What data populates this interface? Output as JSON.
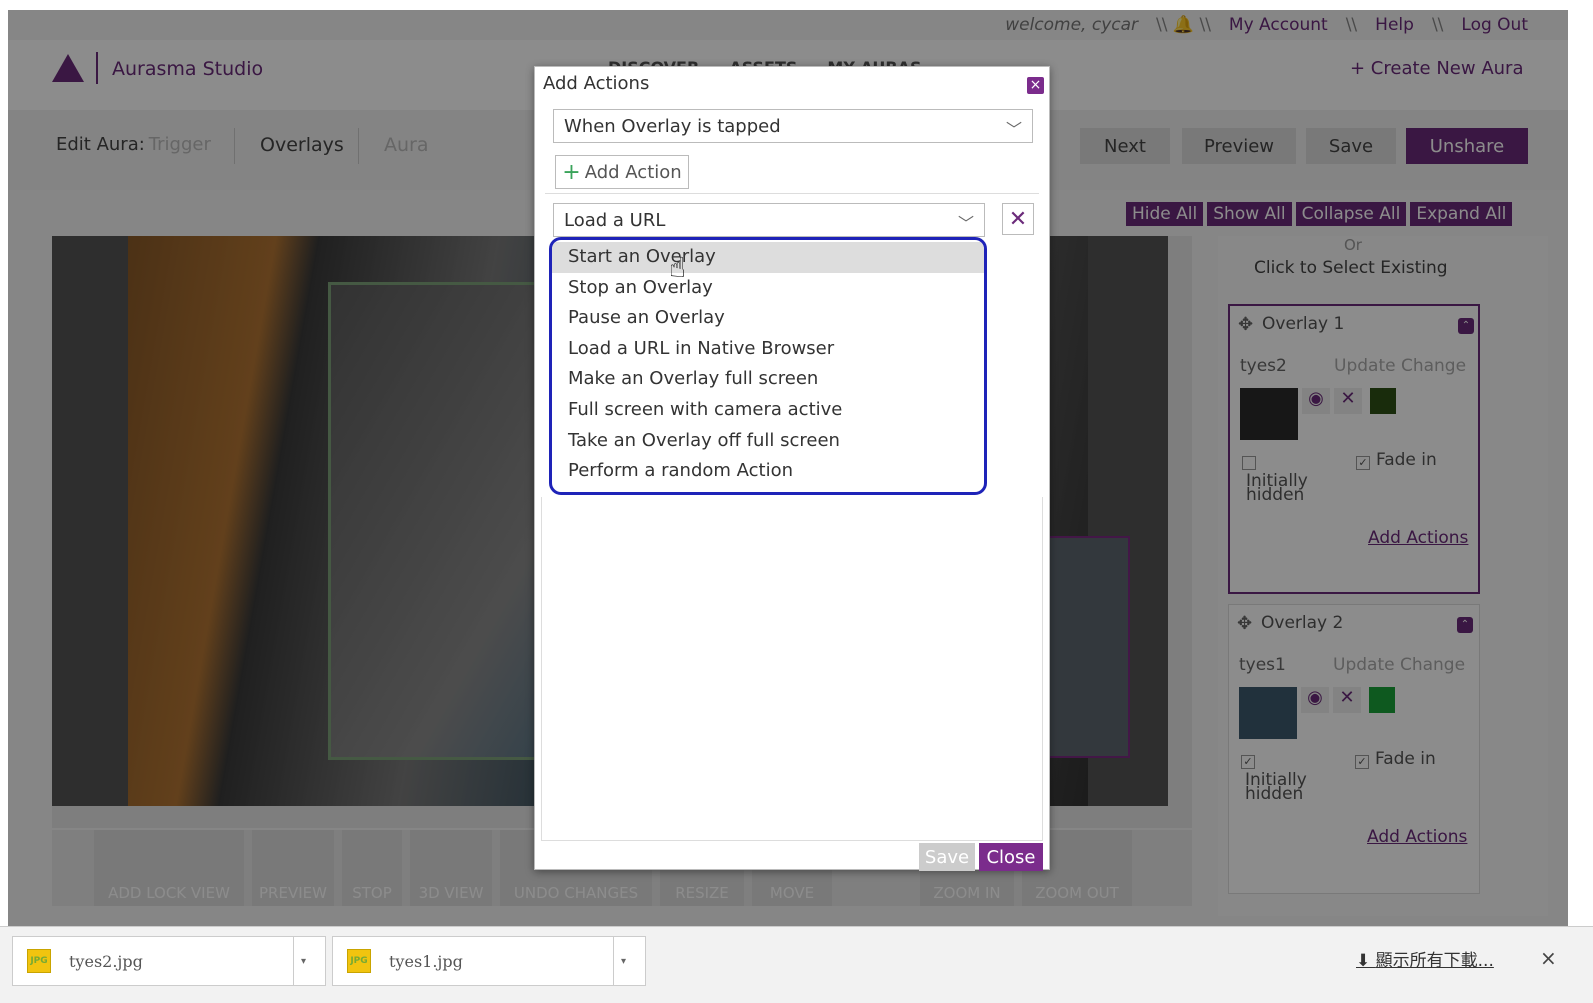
{
  "topbar": {
    "welcome": "welcome, cycar",
    "sep1": "\\\\ 🔔 \\\\",
    "my_account": "My Account",
    "sep2": "\\\\",
    "help": "Help",
    "sep3": "\\\\",
    "logout": "Log Out"
  },
  "header": {
    "logo_text": "Aurasma Studio",
    "nav": [
      "DISCOVER",
      "ASSETS",
      "MY AURAS"
    ],
    "create": "+ Create New Aura"
  },
  "editbar": {
    "label": "Edit Aura:",
    "tabs": [
      "Trigger",
      "Overlays",
      "Aura"
    ],
    "buttons": {
      "next": "Next",
      "preview": "Preview",
      "save": "Save",
      "unshare": "Unshare"
    }
  },
  "toggles": [
    "Hide All",
    "Show All",
    "Collapse All",
    "Expand All"
  ],
  "toolbar": [
    "ADD LOCK VIEW",
    "PREVIEW",
    "STOP",
    "3D VIEW",
    "UNDO CHANGES",
    "RESIZE",
    "MOVE",
    "ZOOM IN",
    "ZOOM OUT"
  ],
  "panel": {
    "or": "Or",
    "select_existing": "Click to Select Existing",
    "overlays": [
      {
        "title": "Overlay 1",
        "name": "tyes2",
        "update": "Update Change",
        "fade": "Fade in",
        "hidden": "Initially hidden",
        "add_actions": "Add Actions",
        "color": "#2e5016",
        "hidden_checked": false
      },
      {
        "title": "Overlay 2",
        "name": "tyes1",
        "update": "Update Change",
        "fade": "Fade in",
        "hidden": "Initially hidden",
        "add_actions": "Add Actions",
        "color": "#1aa339",
        "hidden_checked": true
      }
    ]
  },
  "modal": {
    "title": "Add Actions",
    "trigger_select": "When Overlay is tapped",
    "add_action": "Add Action",
    "action_select": "Load a URL",
    "options": [
      "Start an Overlay",
      "Stop an Overlay",
      "Pause an Overlay",
      "Load a URL in Native Browser",
      "Make an Overlay full screen",
      "Full screen with camera active",
      "Take an Overlay off full screen",
      "Perform a random Action"
    ],
    "highlighted_option": 0,
    "save": "Save",
    "close": "Close"
  },
  "downloads": {
    "items": [
      "tyes2.jpg",
      "tyes1.jpg"
    ],
    "show_all": "顯示所有下載...",
    "close": "×"
  },
  "colors": {
    "brand": "#6b2a7a",
    "highlight_ring": "#1e23b8"
  }
}
